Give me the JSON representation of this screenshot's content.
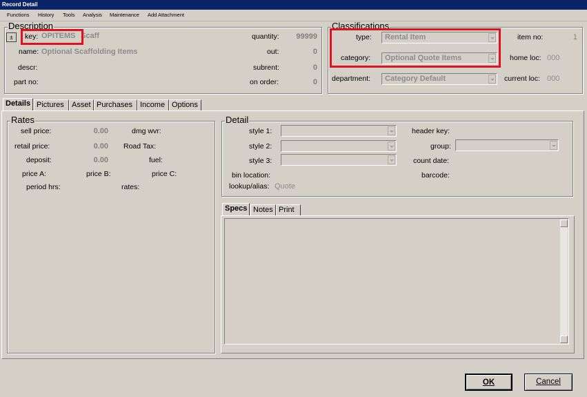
{
  "window": {
    "title": "Record Detail"
  },
  "menu": [
    "Functions",
    "History",
    "Tools",
    "Analysis",
    "Maintenance",
    "Add Attachment"
  ],
  "description": {
    "title": "Description",
    "key_label": "key:",
    "key_value": "OPITEMS",
    "key_suffix": "Scaff",
    "name_label": "name:",
    "name_value": "Optional Scaffolding Items",
    "descr_label": "descr:",
    "partno_label": "part no:",
    "quantity_label": "quantity:",
    "quantity_value": "99999",
    "out_label": "out:",
    "out_value": "0",
    "subrent_label": "subrent:",
    "subrent_value": "0",
    "onorder_label": "on order:",
    "onorder_value": "0"
  },
  "classifications": {
    "title": "Classifications",
    "type_label": "type:",
    "type_value": "Rental Item",
    "category_label": "category:",
    "category_value": "Optional Quote Items",
    "department_label": "department:",
    "department_value": "Category Default",
    "itemno_label": "item no:",
    "itemno_value": "1",
    "homeloc_label": "home loc:",
    "homeloc_value": "000",
    "currentloc_label": "current loc:",
    "currentloc_value": "000"
  },
  "tabs": [
    "Details",
    "Pictures",
    "Asset",
    "Purchases",
    "Income",
    "Options"
  ],
  "rates": {
    "title": "Rates",
    "sell_price_label": "sell price:",
    "sell_price_value": "0.00",
    "dmg_wvr_label": "dmg wvr:",
    "retail_price_label": "retail price:",
    "retail_price_value": "0.00",
    "road_tax_label": "Road Tax:",
    "deposit_label": "deposit:",
    "deposit_value": "0.00",
    "fuel_label": "fuel:",
    "price_a_label": "price A:",
    "price_b_label": "price B:",
    "price_c_label": "price C:",
    "period_hrs_label": "period hrs:",
    "rates_label": "rates:"
  },
  "detail": {
    "title": "Detail",
    "style1_label": "style 1:",
    "style2_label": "style 2:",
    "style3_label": "style 3:",
    "bin_location_label": "bin location:",
    "lookup_alias_label": "lookup/alias:",
    "lookup_alias_value": "Quote",
    "header_key_label": "header key:",
    "group_label": "group:",
    "count_date_label": "count date:",
    "barcode_label": "barcode:"
  },
  "subtabs": [
    "Specs",
    "Notes",
    "Print"
  ],
  "buttons": {
    "ok": "OK",
    "cancel": "Cancel"
  },
  "colors": {
    "highlight": "#e0101c",
    "titlebar": "#0a246a",
    "face": "#d4d0c8"
  }
}
